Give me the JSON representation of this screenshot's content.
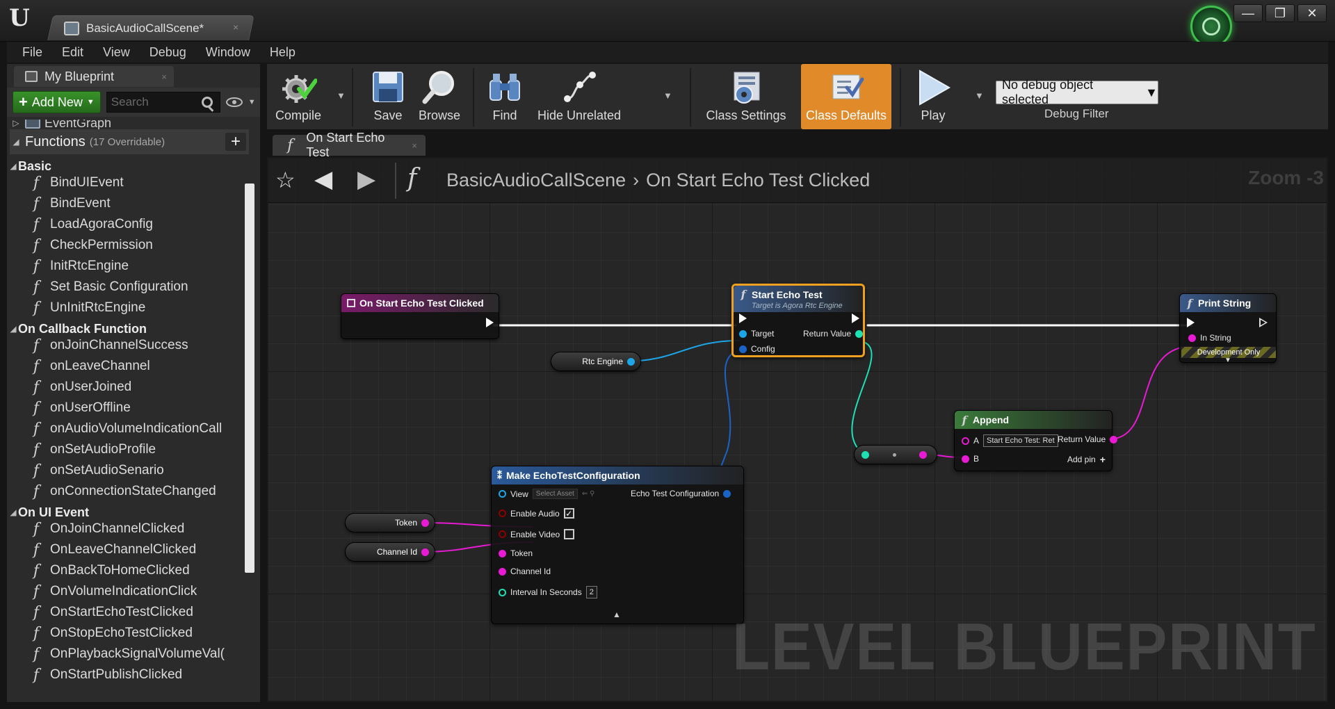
{
  "window": {
    "tab_title": "BasicAudioCallScene*",
    "tab_close": "×",
    "sys_buttons": [
      "—",
      "❐",
      "✕"
    ]
  },
  "menu": [
    "File",
    "Edit",
    "View",
    "Debug",
    "Window",
    "Help"
  ],
  "left_panel": {
    "tab_label": "My Blueprint",
    "tab_close": "×",
    "add_new_label": "Add New",
    "search_placeholder": "Search",
    "eventgraph_label": "EventGraph",
    "functions_title": "Functions",
    "functions_count": "(17 Overridable)",
    "categories": [
      {
        "name": "Basic",
        "items": [
          "BindUIEvent",
          "BindEvent",
          "LoadAgoraConfig",
          "CheckPermission",
          "InitRtcEngine",
          "Set Basic Configuration",
          "UnInitRtcEngine"
        ]
      },
      {
        "name": "On Callback Function",
        "items": [
          "onJoinChannelSuccess",
          "onLeaveChannel",
          "onUserJoined",
          "onUserOffline",
          "onAudioVolumeIndicationCall",
          "onSetAudioProfile",
          "onSetAudioSenario",
          "onConnectionStateChanged"
        ]
      },
      {
        "name": "On UI Event",
        "items": [
          "OnJoinChannelClicked",
          "OnLeaveChannelClicked",
          "OnBackToHomeClicked",
          "OnVolumeIndicationClick",
          "OnStartEchoTestClicked",
          "OnStopEchoTestClicked",
          "OnPlaybackSignalVolumeVal(",
          "OnStartPublishClicked"
        ]
      }
    ]
  },
  "toolbar": {
    "compile": "Compile",
    "save": "Save",
    "browse": "Browse",
    "find": "Find",
    "hide_unrelated": "Hide Unrelated",
    "class_settings": "Class Settings",
    "class_defaults": "Class Defaults",
    "play": "Play",
    "debug_object": "No debug object selected",
    "debug_filter": "Debug Filter"
  },
  "graph_tab": {
    "label": "On Start Echo Test",
    "close": "×"
  },
  "graph": {
    "breadcrumb_root": "BasicAudioCallScene",
    "breadcrumb_current": "On Start Echo Test Clicked",
    "zoom": "Zoom -3",
    "watermark": "LEVEL BLUEPRINT",
    "nodes": {
      "event": {
        "title": "On Start Echo Test Clicked"
      },
      "start_echo": {
        "title": "Start Echo Test",
        "subtitle": "Target is Agora Rtc Engine",
        "target": "Target",
        "config": "Config",
        "return": "Return Value"
      },
      "print_string": {
        "title": "Print String",
        "in_string": "In String",
        "dev_only": "Development Only"
      },
      "append": {
        "title": "Append",
        "a": "A",
        "a_value": "Start Echo Test: Ret",
        "b": "B",
        "return": "Return Value",
        "add_pin": "Add pin"
      },
      "rtc_engine": {
        "label": "Rtc Engine"
      },
      "make_config": {
        "title": "Make EchoTestConfiguration",
        "view": "View",
        "select_asset": "Select Asset",
        "output": "Echo Test Configuration",
        "enable_audio": "Enable Audio",
        "enable_video": "Enable Video",
        "token": "Token",
        "channel_id": "Channel Id",
        "interval": "Interval In Seconds",
        "interval_value": "2"
      },
      "token_var": {
        "label": "Token"
      },
      "channel_var": {
        "label": "Channel Id"
      }
    }
  },
  "colors": {
    "exec": "#ffffff",
    "object_pin": "#1ca6e8",
    "struct_pin": "#1a64c8",
    "string_pin": "#e81ad4",
    "int_pin": "#1fe0b4",
    "bool_pin": "#8c0000",
    "selected_outline": "#f0a020",
    "class_defaults_bg": "#e08a2a"
  }
}
